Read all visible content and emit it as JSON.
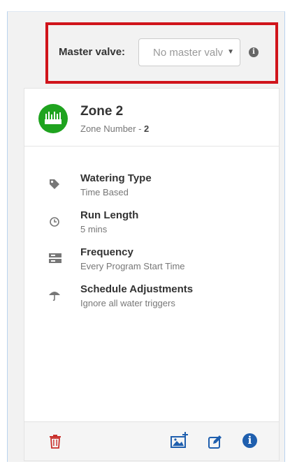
{
  "master_valve": {
    "label": "Master valve:",
    "selected": "No master valve",
    "info_icon": "info-circle-icon"
  },
  "zone": {
    "title": "Zone 2",
    "number_label": "Zone Number - ",
    "number": "2",
    "icon": "sprinkler-zone-icon",
    "accent": "#1fa31f"
  },
  "details": [
    {
      "icon": "tag-icon",
      "title": "Watering Type",
      "value": "Time Based"
    },
    {
      "icon": "clock-icon",
      "title": "Run Length",
      "value": "5 mins"
    },
    {
      "icon": "server-icon",
      "title": "Frequency",
      "value": "Every Program Start Time"
    },
    {
      "icon": "umbrella-icon",
      "title": "Schedule Adjustments",
      "value": "Ignore all water triggers"
    }
  ],
  "footer": {
    "delete_icon": "trash-icon",
    "add_image_icon": "add-image-icon",
    "edit_icon": "edit-icon",
    "info_icon": "info-circle-icon",
    "delete_color": "#c9302c",
    "action_color": "#1f5fae"
  }
}
